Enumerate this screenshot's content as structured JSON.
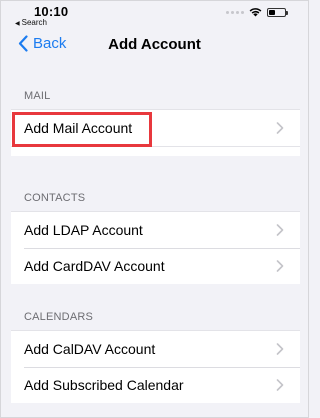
{
  "status_bar": {
    "time": "10:10",
    "back_app": "Search",
    "battery_level_percent": 40,
    "icons": [
      "cellular-dots-icon",
      "wifi-icon",
      "battery-icon"
    ]
  },
  "nav": {
    "back_label": "Back",
    "title": "Add Account"
  },
  "sections": {
    "mail": {
      "header": "MAIL",
      "items": [
        {
          "label": "Add Mail Account",
          "highlighted": true
        }
      ]
    },
    "contacts": {
      "header": "CONTACTS",
      "items": [
        {
          "label": "Add LDAP Account"
        },
        {
          "label": "Add CardDAV Account"
        }
      ]
    },
    "calendars": {
      "header": "CALENDARS",
      "items": [
        {
          "label": "Add CalDAV Account"
        },
        {
          "label": "Add Subscribed Calendar"
        }
      ]
    }
  },
  "colors": {
    "accent": "#1c7cf0",
    "background": "#f2f2f7",
    "highlight_box": "#e8383d"
  }
}
